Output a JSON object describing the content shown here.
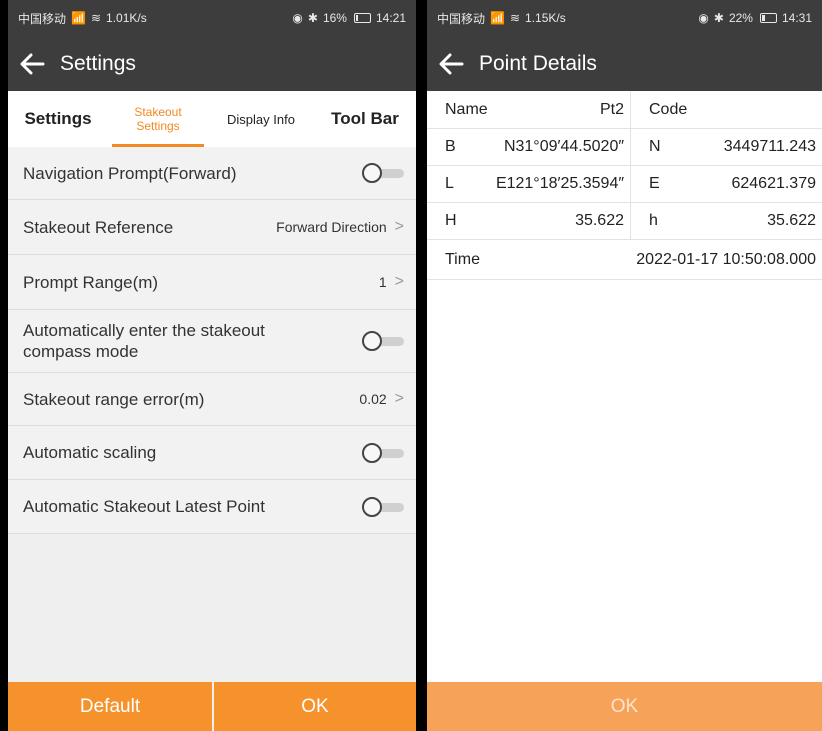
{
  "left_screen": {
    "status": {
      "carrier": "中国移动",
      "net_speed": "1.01K/s",
      "battery": "16%",
      "battery_level": 0.16,
      "time": "14:21"
    },
    "title": "Settings",
    "tabs": [
      {
        "label": "Settings"
      },
      {
        "label": "Stakeout Settings",
        "active": true
      },
      {
        "label": "Display Info"
      },
      {
        "label": "Tool Bar"
      }
    ],
    "rows": [
      {
        "label": "Navigation Prompt(Forward)",
        "type": "toggle",
        "on": false
      },
      {
        "label": "Stakeout Reference",
        "type": "select",
        "value": "Forward Direction"
      },
      {
        "label": "Prompt Range(m)",
        "type": "select",
        "value": "1"
      },
      {
        "label": "Automatically enter the stakeout compass mode",
        "type": "toggle",
        "on": false
      },
      {
        "label": "Stakeout range error(m)",
        "type": "select",
        "value": "0.02"
      },
      {
        "label": "Automatic scaling",
        "type": "toggle",
        "on": false
      },
      {
        "label": "Automatic Stakeout Latest Point",
        "type": "toggle",
        "on": false
      }
    ],
    "buttons": {
      "default_label": "Default",
      "ok_label": "OK"
    }
  },
  "right_screen": {
    "status": {
      "carrier": "中国移动",
      "net_speed": "1.15K/s",
      "battery": "22%",
      "battery_level": 0.22,
      "time": "14:31"
    },
    "title": "Point Details",
    "details": {
      "name_label": "Name",
      "name_value": "Pt2",
      "code_label": "Code",
      "code_value": "",
      "b_label": "B",
      "b_value": "N31°09′44.5020″",
      "n_label": "N",
      "n_value": "3449711.243",
      "l_label": "L",
      "l_value": "E121°18′25.3594″",
      "e_label": "E",
      "e_value": "624621.379",
      "h_label": "H",
      "h_value": "35.622",
      "h2_label": "h",
      "h2_value": "35.622",
      "time_label": "Time",
      "time_value": "2022-01-17 10:50:08.000"
    },
    "ok_label": "OK"
  },
  "colors": {
    "accent": "#f6922b",
    "header_bg": "#3d3d3d",
    "tab_active": "#f08a24"
  }
}
